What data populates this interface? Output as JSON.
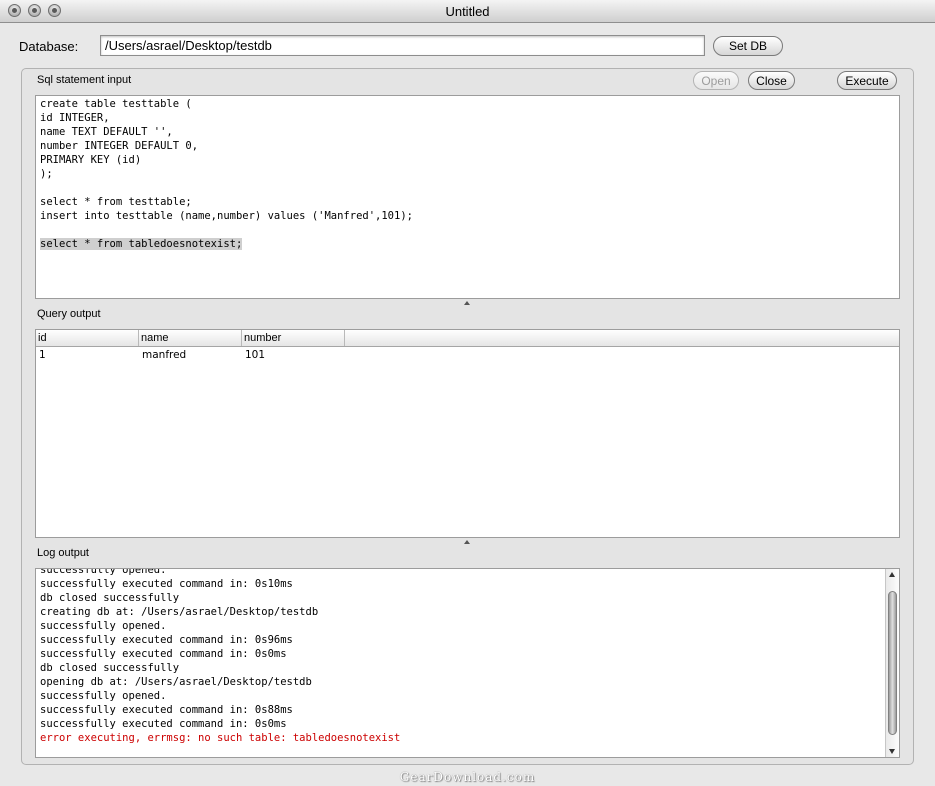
{
  "window": {
    "title": "Untitled"
  },
  "database": {
    "label": "Database:",
    "path": "/Users/asrael/Desktop/testdb",
    "set_button": "Set DB"
  },
  "sql_input": {
    "label": "Sql statement input",
    "open_button": "Open",
    "close_button": "Close",
    "execute_button": "Execute",
    "lines": [
      "create table testtable (",
      "id INTEGER,",
      "name TEXT DEFAULT '',",
      "number INTEGER DEFAULT 0,",
      "PRIMARY KEY (id)",
      ");",
      "",
      "select * from testtable;",
      "insert into testtable (name,number) values ('Manfred',101);",
      "",
      "select * from tabledoesnotexist;"
    ]
  },
  "query_output": {
    "label": "Query output",
    "columns": [
      "id",
      "name",
      "number"
    ],
    "rows": [
      [
        "1",
        "manfred",
        "101"
      ]
    ]
  },
  "log_output": {
    "label": "Log output",
    "lines": [
      {
        "text": "successfully opened.",
        "error": false
      },
      {
        "text": "successfully executed command in: 0s10ms",
        "error": false
      },
      {
        "text": "db closed successfully",
        "error": false
      },
      {
        "text": "creating db at: /Users/asrael/Desktop/testdb",
        "error": false
      },
      {
        "text": "successfully opened.",
        "error": false
      },
      {
        "text": "successfully executed command in: 0s96ms",
        "error": false
      },
      {
        "text": "successfully executed command in: 0s0ms",
        "error": false
      },
      {
        "text": "db closed successfully",
        "error": false
      },
      {
        "text": "opening db at: /Users/asrael/Desktop/testdb",
        "error": false
      },
      {
        "text": "successfully opened.",
        "error": false
      },
      {
        "text": "successfully executed command in: 0s88ms",
        "error": false
      },
      {
        "text": "successfully executed command in: 0s0ms",
        "error": false
      },
      {
        "text": "error executing, errmsg: no such table: tabledoesnotexist",
        "error": true
      }
    ],
    "error_color": "#cc0000"
  },
  "watermark": "GearDownload.com"
}
